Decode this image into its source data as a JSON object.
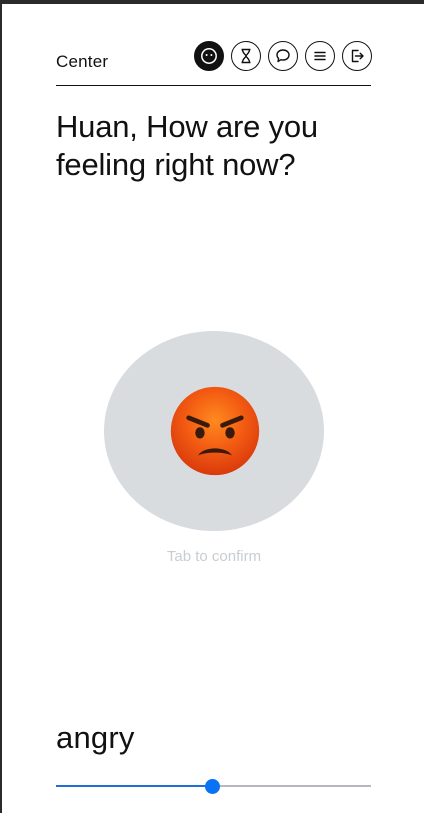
{
  "header": {
    "title": "Center",
    "nav": [
      {
        "icon": "smiley-icon",
        "active": true
      },
      {
        "icon": "hourglass-icon",
        "active": false
      },
      {
        "icon": "chat-bubbles-icon",
        "active": false
      },
      {
        "icon": "menu-icon",
        "active": false
      },
      {
        "icon": "logout-icon",
        "active": false
      }
    ]
  },
  "main": {
    "question": "Huan, How are you feeling right now?",
    "mood_emoji": "angry-face-emoji",
    "hint": "Tab to confirm",
    "mood_label": "angry",
    "slider_value": 0.495
  },
  "colors": {
    "accent": "#0a72f5",
    "disc": "#d9dcdf",
    "hint": "#c9cdd1",
    "text": "#111111"
  }
}
